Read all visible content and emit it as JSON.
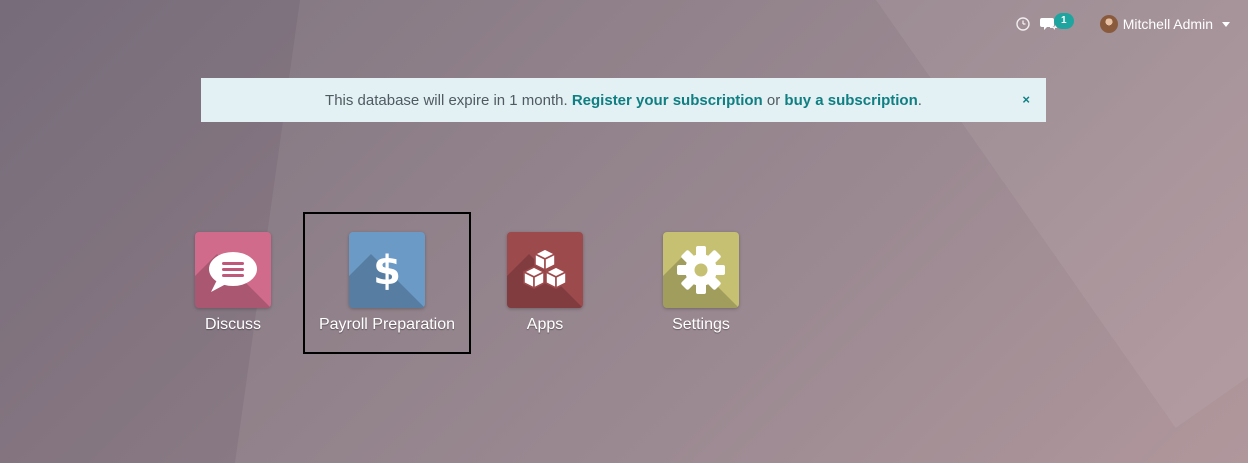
{
  "systray": {
    "activity_icon": "clock-icon",
    "messaging_icon": "chat-bubbles-icon",
    "messaging_badge": "1",
    "user_name": "Mitchell Admin"
  },
  "alert": {
    "text_before": "This database will expire in 1 month. ",
    "register_link": "Register your subscription",
    "text_middle": " or ",
    "buy_link": "buy a subscription",
    "text_after": ".",
    "close": "×"
  },
  "apps": [
    {
      "label": "Discuss",
      "icon": "chat-bubble-icon",
      "color": "#d06b8c"
    },
    {
      "label": "Payroll Preparation",
      "icon": "dollar-icon",
      "color": "#6b9ac6"
    },
    {
      "label": "Apps",
      "icon": "cubes-icon",
      "color": "#9d4a4d"
    },
    {
      "label": "Settings",
      "icon": "gear-icon",
      "color": "#c5c072"
    }
  ],
  "selected_app": "Payroll Preparation"
}
